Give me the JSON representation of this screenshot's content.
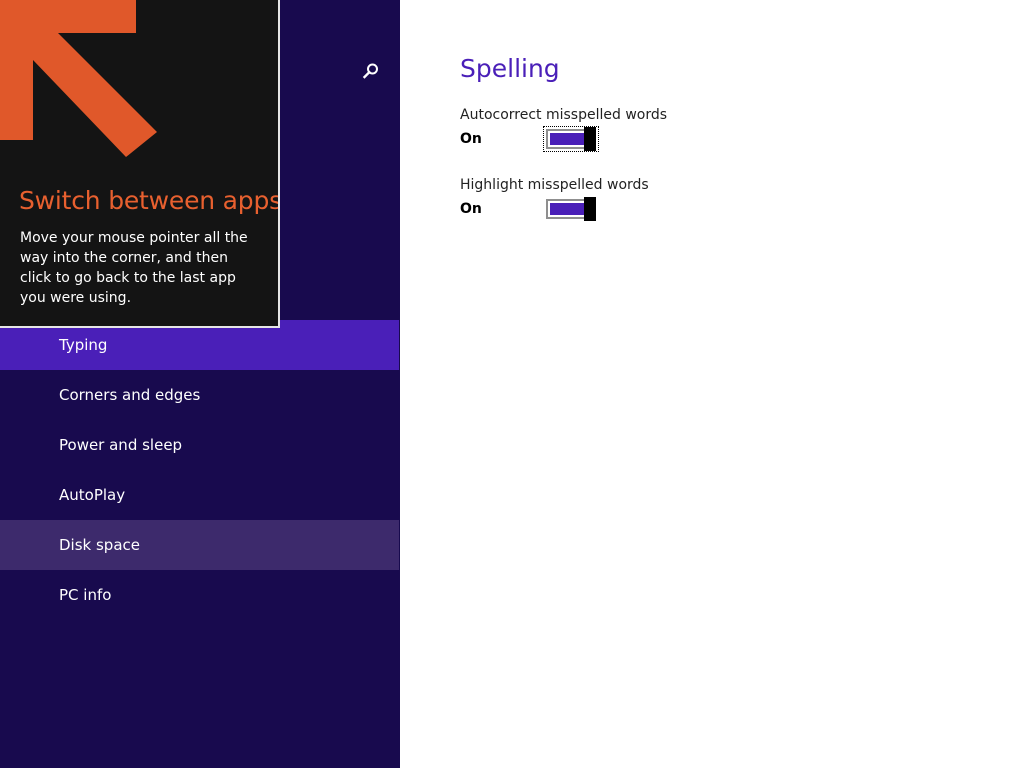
{
  "colors": {
    "nav_background": "#180a4e",
    "nav_selected": "#4a1fb8",
    "nav_hover": "#3d2a6c",
    "accent": "#4a1fb8",
    "tip_background": "#141414",
    "tip_title": "#e8602f",
    "tip_arrow": "#e0582a"
  },
  "search": {
    "icon": "search-icon"
  },
  "tip": {
    "arrow_icon": "arrow-up-left-icon",
    "title": "Switch between apps",
    "body": "Move your mouse pointer all the way into the corner, and then click to go back to the last app you were using."
  },
  "nav": {
    "items": [
      {
        "label": "Typing",
        "state": "selected"
      },
      {
        "label": "Corners and edges",
        "state": ""
      },
      {
        "label": "Power and sleep",
        "state": ""
      },
      {
        "label": "AutoPlay",
        "state": ""
      },
      {
        "label": "Disk space",
        "state": "hover"
      },
      {
        "label": "PC info",
        "state": ""
      }
    ]
  },
  "main": {
    "section_title": "Spelling",
    "settings": [
      {
        "label": "Autocorrect misspelled words",
        "state": "On",
        "on": true
      },
      {
        "label": "Highlight misspelled words",
        "state": "On",
        "on": true
      }
    ]
  }
}
